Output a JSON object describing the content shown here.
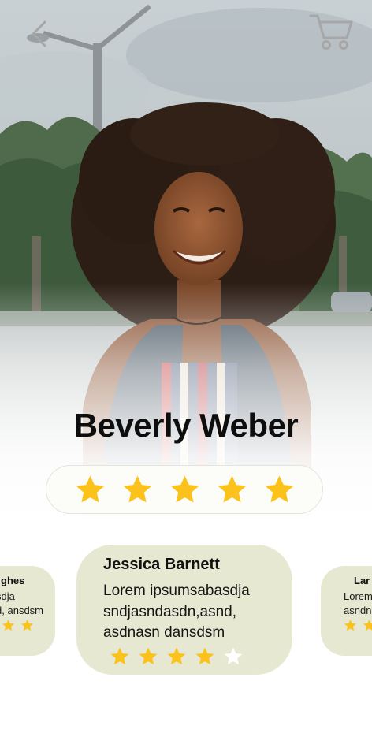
{
  "header": {
    "back_icon": "chevron-left-icon",
    "cart_icon": "shopping-cart-icon"
  },
  "profile": {
    "name": "Beverly Weber",
    "rating": 5,
    "max_rating": 5
  },
  "reviews": [
    {
      "position": "left-partial",
      "name": "ghes",
      "text": "msabasdja dn,asnd, ansdsm",
      "rating": 2
    },
    {
      "position": "center",
      "name": "Jessica Barnett",
      "text": "Lorem ipsumsabasdja sndjasndasdn,asnd, asdnasn dansdsm",
      "rating": 4,
      "max_rating": 5
    },
    {
      "position": "right-partial",
      "name": "Lar",
      "text": "Lorem sndjas asndn",
      "rating": 2
    }
  ],
  "colors": {
    "star_filled": "#fbc21b",
    "star_empty": "#ffffff",
    "card_background": "#e6e8d1",
    "icon_gray": "#a7a7a7",
    "name_text": "#0d0d0d"
  }
}
